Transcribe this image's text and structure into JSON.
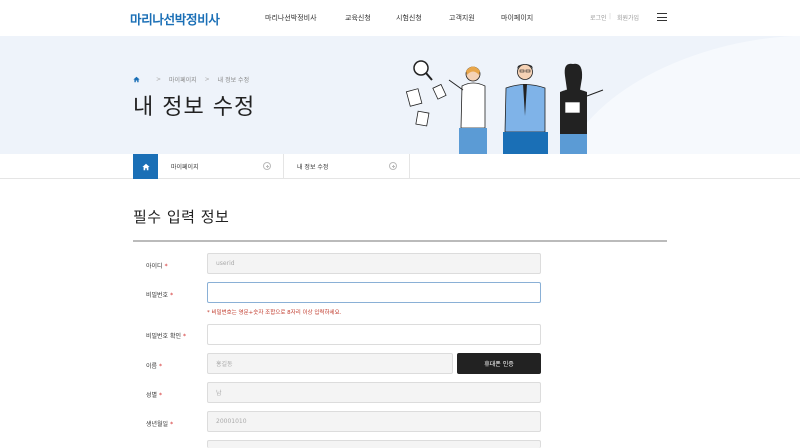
{
  "header": {
    "logo": "마리나선박정비사",
    "nav": [
      "마리나선박정비사",
      "교육신청",
      "시험신청",
      "고객지원",
      "마이페이지"
    ],
    "login": "로그인",
    "util_sep": "|",
    "join": "회원가입"
  },
  "hero": {
    "breadcrumb": [
      "마이페이지",
      "내 정보 수정"
    ],
    "breadcrumb_sep": ">",
    "title": "내 정보 수정"
  },
  "subnav": {
    "items": [
      "마이페이지",
      "내 정보 수정"
    ]
  },
  "form": {
    "section_title": "필수 입력 정보",
    "required_mark": "*",
    "fields": {
      "id": {
        "label": "아이디",
        "value": "userid"
      },
      "password": {
        "label": "비밀번호",
        "value": ""
      },
      "password_hint": "* 비밀번호는 영문+숫자 조합으로 8자리 이상 입력하세요.",
      "password_confirm": {
        "label": "비밀번호 확인",
        "value": ""
      },
      "name": {
        "label": "이름",
        "value": "홍길동",
        "button": "휴대폰 인증"
      },
      "gender": {
        "label": "성별",
        "value": "남"
      },
      "birth": {
        "label": "생년월일",
        "value": "20001010"
      }
    }
  },
  "colors": {
    "brand": "#1a6fb6",
    "hero_bg": "#eef3fa",
    "required": "#d32f2f",
    "button_dark": "#222222"
  }
}
